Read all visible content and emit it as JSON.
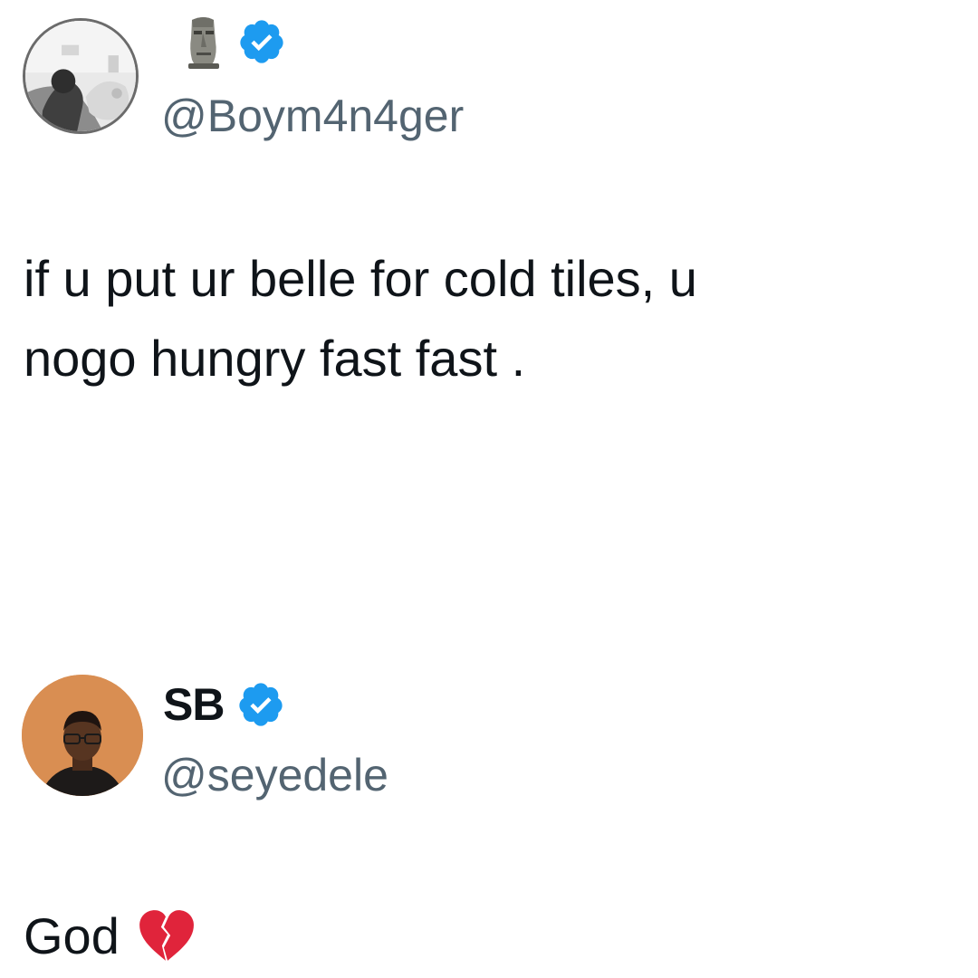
{
  "tweets": [
    {
      "display_name": "",
      "handle": "@Boym4n4ger",
      "verified": true,
      "name_emoji_icon": "moai-icon",
      "text": "if u put ur belle for cold tiles, u\nnogo hungry fast fast ."
    },
    {
      "display_name": "SB",
      "handle": "@seyedele",
      "verified": true,
      "text": "God",
      "text_emoji_icon": "broken-heart-icon"
    }
  ],
  "colors": {
    "text_primary": "#0f1419",
    "text_secondary": "#536471",
    "verified_blue": "#1d9bf0",
    "broken_heart_red": "#e0243b",
    "background": "#ffffff"
  }
}
